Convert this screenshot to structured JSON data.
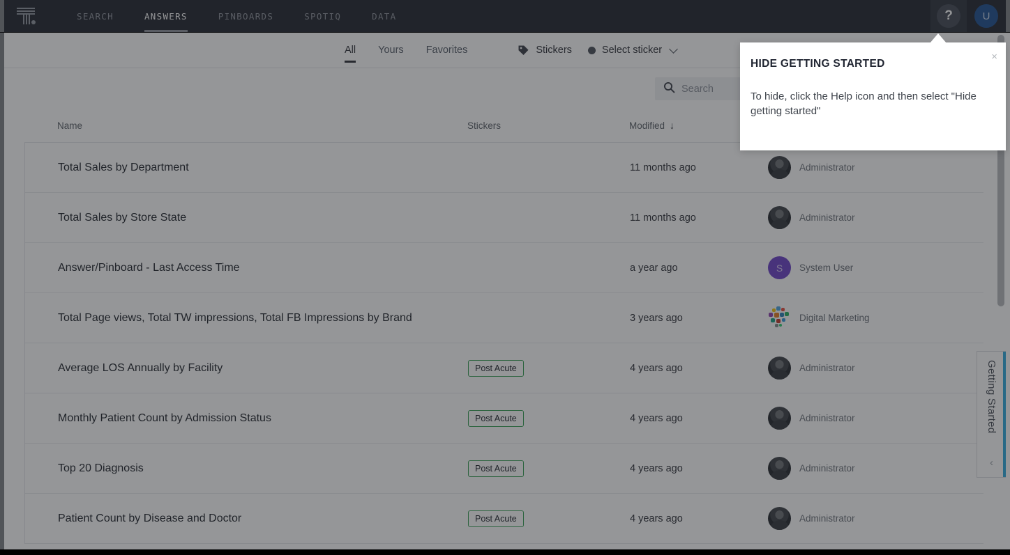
{
  "nav": {
    "logo_name": "thoughtspot-logo",
    "items": [
      {
        "label": "SEARCH",
        "active": false
      },
      {
        "label": "ANSWERS",
        "active": true
      },
      {
        "label": "PINBOARDS",
        "active": false
      },
      {
        "label": "SPOTIQ",
        "active": false
      },
      {
        "label": "DATA",
        "active": false
      }
    ],
    "help_label": "?",
    "avatar_initial": "U",
    "bg_color": "#21262e",
    "avatar_color": "#1d4f91"
  },
  "filters": {
    "tabs": [
      {
        "label": "All",
        "active": true
      },
      {
        "label": "Yours",
        "active": false
      },
      {
        "label": "Favorites",
        "active": false
      }
    ],
    "stickers_label": "Stickers",
    "select_sticker_label": "Select sticker"
  },
  "search": {
    "placeholder": "Search",
    "value": ""
  },
  "table": {
    "headers": {
      "name": "Name",
      "stickers": "Stickers",
      "modified": "Modified",
      "sort_arrow": "↓"
    },
    "rows": [
      {
        "name": "Total Sales by Department",
        "sticker": "",
        "modified": "11 months ago",
        "author": "Administrator",
        "avatar_type": "admin"
      },
      {
        "name": "Total Sales by Store State",
        "sticker": "",
        "modified": "11 months ago",
        "author": "Administrator",
        "avatar_type": "admin"
      },
      {
        "name": "Answer/Pinboard - Last Access Time",
        "sticker": "",
        "modified": "a year ago",
        "author": "System User",
        "avatar_type": "system",
        "avatar_initial": "S"
      },
      {
        "name": "Total Page views, Total TW impressions, Total FB Impressions by Brand",
        "sticker": "",
        "modified": "3 years ago",
        "author": "Digital Marketing",
        "avatar_type": "digital"
      },
      {
        "name": "Average LOS Annually by Facility",
        "sticker": "Post Acute",
        "modified": "4 years ago",
        "author": "Administrator",
        "avatar_type": "admin"
      },
      {
        "name": "Monthly Patient Count by Admission Status",
        "sticker": "Post Acute",
        "modified": "4 years ago",
        "author": "Administrator",
        "avatar_type": "admin"
      },
      {
        "name": "Top 20 Diagnosis",
        "sticker": "Post Acute",
        "modified": "4 years ago",
        "author": "Administrator",
        "avatar_type": "admin"
      },
      {
        "name": "Patient Count by Disease and Doctor",
        "sticker": "Post Acute",
        "modified": "4 years ago",
        "author": "Administrator",
        "avatar_type": "admin"
      }
    ],
    "sticker_border_color": "#3aa256"
  },
  "getting_started": {
    "label": "Getting Started",
    "chevron": "‹",
    "accent_color": "#2eaadc"
  },
  "tooltip": {
    "title": "HIDE GETTING STARTED",
    "body": "To hide, click the Help icon and then select \"Hide getting started\"",
    "close": "×"
  }
}
